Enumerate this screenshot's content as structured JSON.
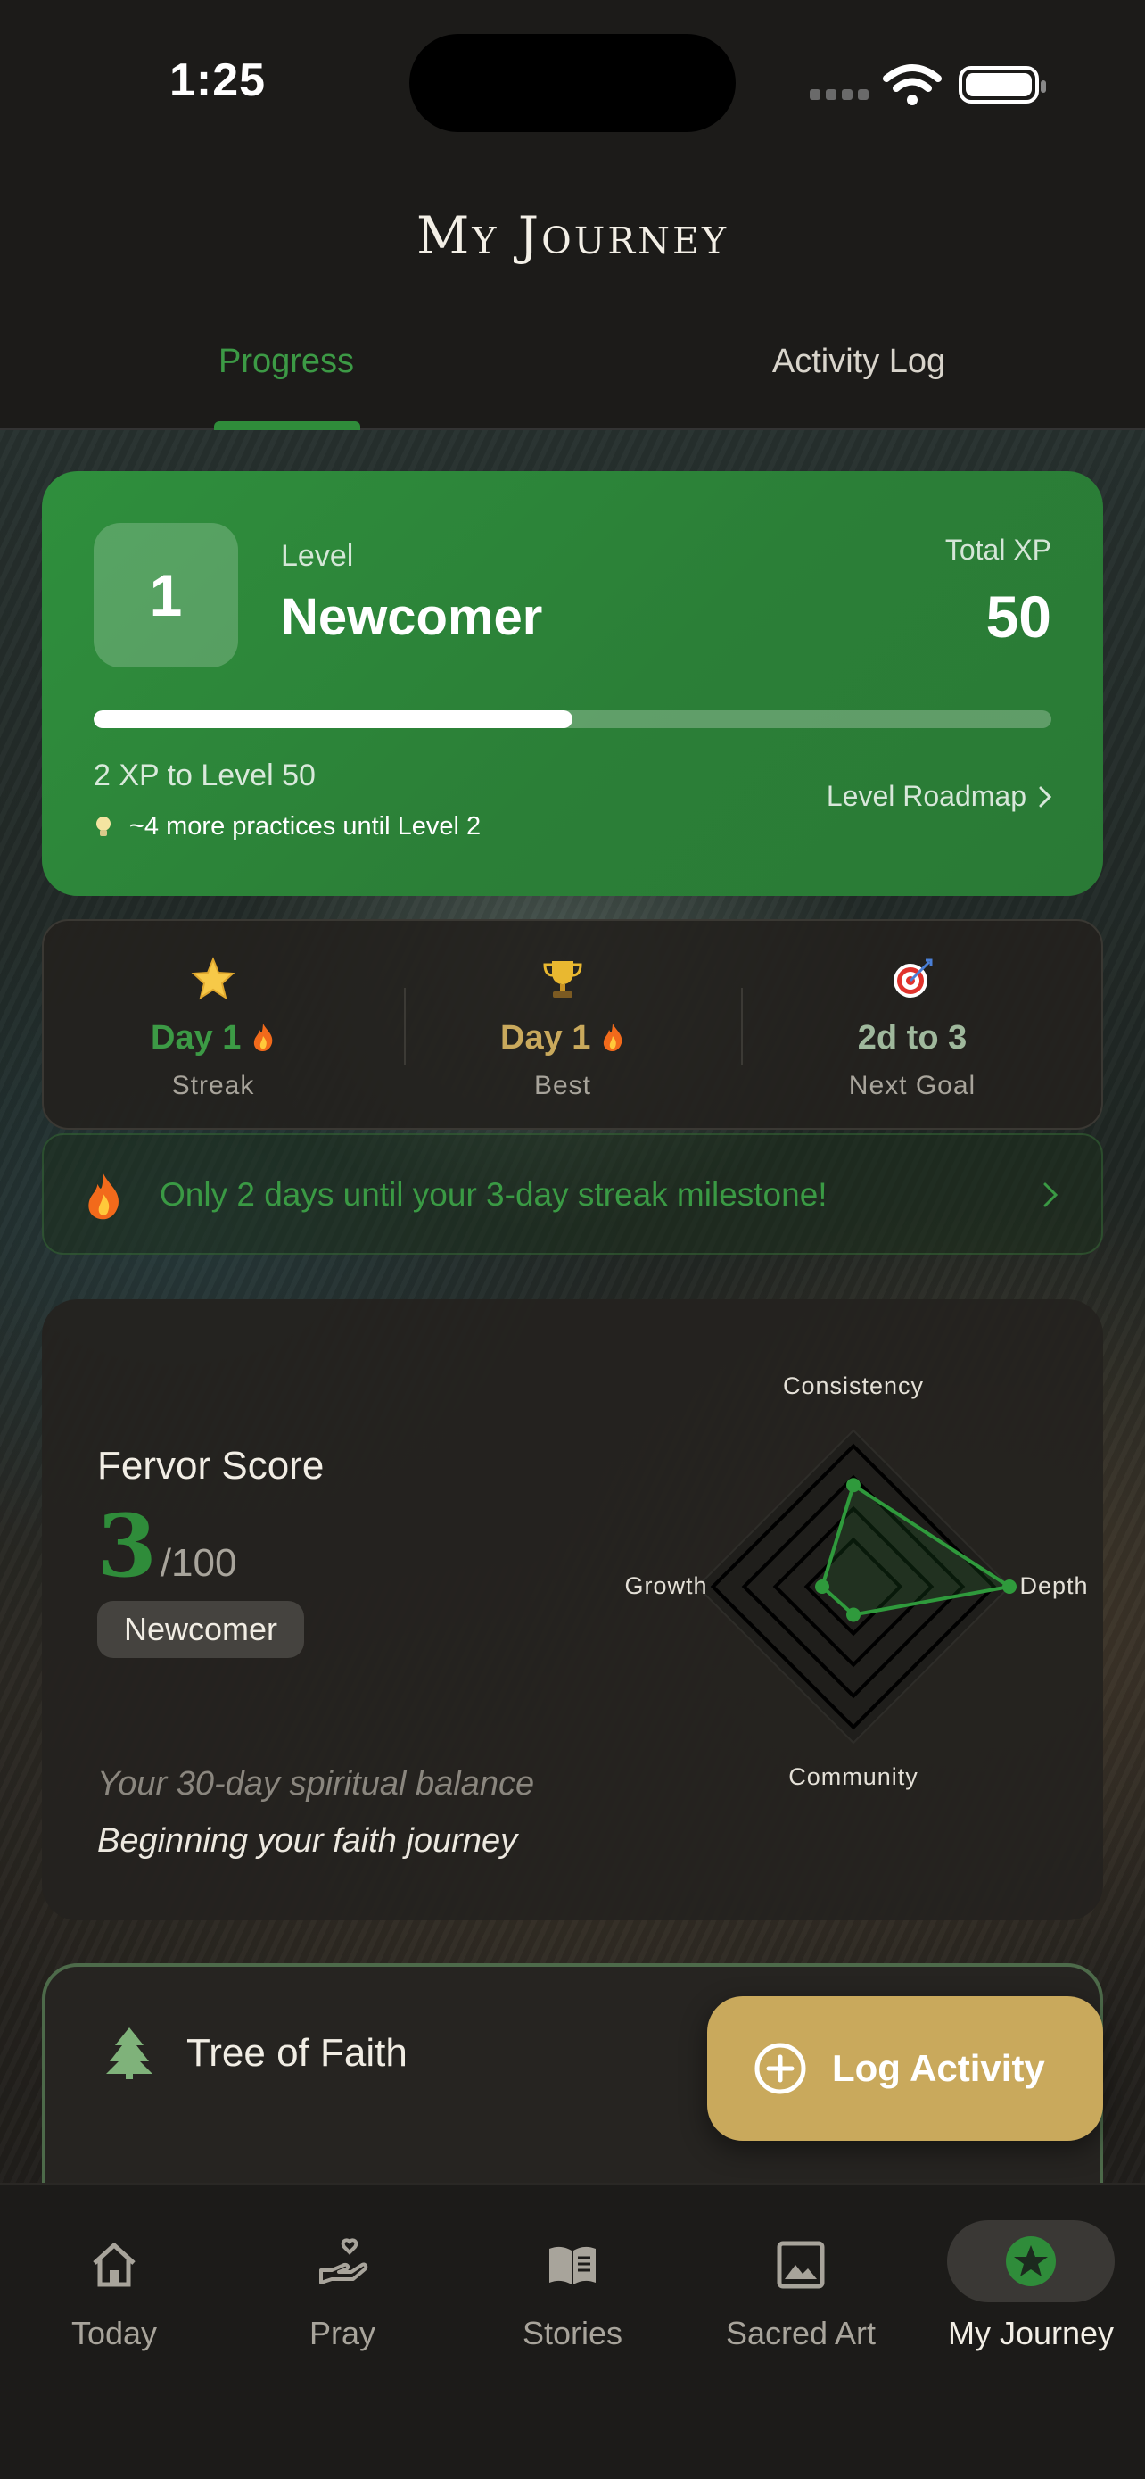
{
  "status_bar": {
    "time": "1:25"
  },
  "header": {
    "title": "My Journey"
  },
  "tabs": [
    {
      "label": "Progress",
      "active": true
    },
    {
      "label": "Activity Log",
      "active": false
    }
  ],
  "level_card": {
    "level_number": "1",
    "level_label": "Level",
    "level_name": "Newcomer",
    "total_xp_label": "Total XP",
    "total_xp": "50",
    "progress_fraction": 0.5,
    "xp_to_level": "2 XP to Level 50",
    "practices_hint": "~4 more practices until Level 2",
    "roadmap_label": "Level Roadmap"
  },
  "stats": [
    {
      "value": "Day 1",
      "label": "Streak",
      "icon": "star-icon",
      "has_flame": true,
      "color": "#3c9a45"
    },
    {
      "value": "Day 1",
      "label": "Best",
      "icon": "trophy-icon",
      "has_flame": true,
      "color": "#c9a95c"
    },
    {
      "value": "2d to 3",
      "label": "Next Goal",
      "icon": "target-icon",
      "has_flame": false,
      "color": "#9fb89c"
    }
  ],
  "milestone": {
    "message": "Only 2 days until your 3-day streak milestone!"
  },
  "fervor": {
    "title": "Fervor Score",
    "score": "3",
    "max": "/100",
    "badge": "Newcomer",
    "balance_text": "Your 30-day spiritual balance",
    "status_text": "Beginning your faith journey",
    "radar_axes": {
      "top": "Consistency",
      "right": "Depth",
      "bottom": "Community",
      "left": "Growth"
    },
    "radar_values": {
      "consistency": 0.65,
      "depth": 1.0,
      "community": 0.18,
      "growth": 0.2
    }
  },
  "tree": {
    "title": "Tree of Faith"
  },
  "fab": {
    "label": "Log Activity"
  },
  "bottom_nav": [
    {
      "label": "Today",
      "icon": "home-icon"
    },
    {
      "label": "Pray",
      "icon": "praying-hand-heart-icon"
    },
    {
      "label": "Stories",
      "icon": "book-icon"
    },
    {
      "label": "Sacred Art",
      "icon": "image-icon"
    },
    {
      "label": "My Journey",
      "icon": "star-badge-icon",
      "active": true
    }
  ],
  "colors": {
    "accent_green": "#2f8c3a",
    "gold": "#c9a95c",
    "background": "#1c1b19",
    "card": "#24221f"
  }
}
